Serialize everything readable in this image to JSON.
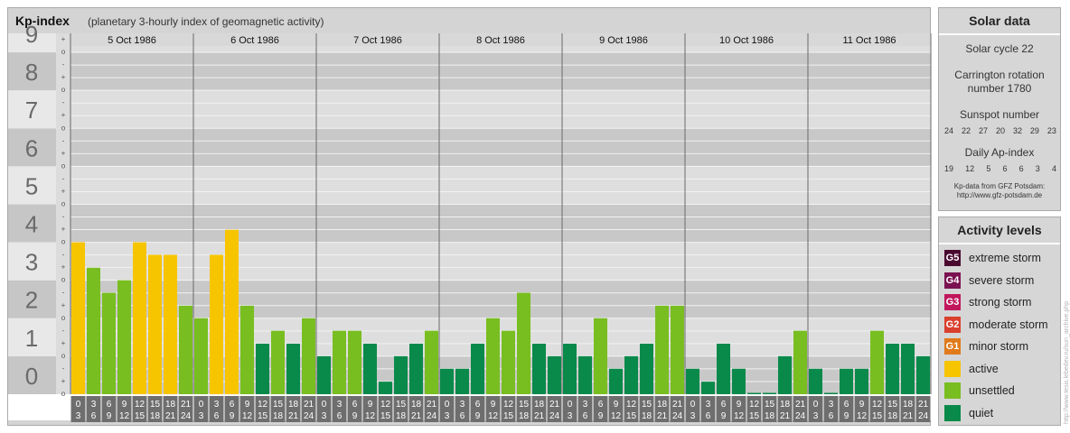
{
  "header": {
    "title": "Kp-index",
    "subtitle": "(planetary 3-hourly index of geomagnetic activity)"
  },
  "chart_data": {
    "type": "bar",
    "title": "Kp-index",
    "subtitle": "(planetary 3-hourly index of geomagnetic activity)",
    "y_major_ticks": [
      "0",
      "1",
      "2",
      "3",
      "4",
      "5",
      "6",
      "7",
      "8",
      "9"
    ],
    "y_minor_ticks": [
      "o",
      "+",
      "-"
    ],
    "ylim": [
      0,
      9
    ],
    "days": [
      "5 Oct 1986",
      "6 Oct 1986",
      "7 Oct 1986",
      "8 Oct 1986",
      "9 Oct 1986",
      "10 Oct 1986",
      "11 Oct 1986"
    ],
    "interval_labels": [
      [
        "0",
        "3"
      ],
      [
        "3",
        "6"
      ],
      [
        "6",
        "9"
      ],
      [
        "9",
        "12"
      ],
      [
        "12",
        "15"
      ],
      [
        "15",
        "18"
      ],
      [
        "18",
        "21"
      ],
      [
        "21",
        "24"
      ]
    ],
    "values": [
      [
        4.0,
        3.33,
        2.67,
        3.0,
        4.0,
        3.67,
        3.67,
        2.33
      ],
      [
        2.0,
        3.67,
        4.33,
        2.33,
        1.33,
        1.67,
        1.33,
        2.0
      ],
      [
        1.0,
        1.67,
        1.67,
        1.33,
        0.33,
        1.0,
        1.33,
        1.67
      ],
      [
        0.67,
        0.67,
        1.33,
        2.0,
        1.67,
        2.67,
        1.33,
        1.0
      ],
      [
        1.33,
        1.0,
        2.0,
        0.67,
        1.0,
        1.33,
        2.33,
        2.33
      ],
      [
        0.67,
        0.33,
        1.33,
        0.67,
        0.0,
        0.0,
        1.0,
        1.67
      ],
      [
        0.67,
        0.0,
        0.67,
        0.67,
        1.67,
        1.33,
        1.33,
        1.0
      ]
    ],
    "level_colors": {
      "quiet": "#0a8a4a",
      "unsettled": "#78be20",
      "active": "#f7c400",
      "G1": "#e07a1a",
      "G2": "#d9402e",
      "G3": "#c0175c",
      "G4": "#7a1251",
      "G5": "#4a0a30"
    },
    "grid": true
  },
  "solar": {
    "title": "Solar data",
    "cycle": "Solar cycle 22",
    "carrington_line1": "Carrington rotation",
    "carrington_line2": "number 1780",
    "sunspot_title": "Sunspot number",
    "sunspot_values": [
      "24",
      "22",
      "27",
      "20",
      "32",
      "29",
      "23"
    ],
    "ap_title": "Daily Ap-index",
    "ap_values": [
      "19",
      "12",
      "5",
      "6",
      "6",
      "3",
      "4"
    ],
    "source_line1": "Kp-data from GFZ Potsdam:",
    "source_line2": "http://www.gfz-potsdam.de"
  },
  "activity": {
    "title": "Activity levels",
    "items": [
      {
        "code": "G5",
        "label": "extreme storm",
        "color": "#4a0a30"
      },
      {
        "code": "G4",
        "label": "severe storm",
        "color": "#7a1251"
      },
      {
        "code": "G3",
        "label": "strong storm",
        "color": "#c0175c"
      },
      {
        "code": "G2",
        "label": "moderate storm",
        "color": "#d9402e"
      },
      {
        "code": "G1",
        "label": "minor storm",
        "color": "#e07a1a"
      },
      {
        "code": "",
        "label": "active",
        "color": "#f7c400"
      },
      {
        "code": "",
        "label": "unsettled",
        "color": "#78be20"
      },
      {
        "code": "",
        "label": "quiet",
        "color": "#0a8a4a"
      }
    ]
  },
  "watermark": "http://www.tesis.lebedev.ru/sun_archive.php"
}
